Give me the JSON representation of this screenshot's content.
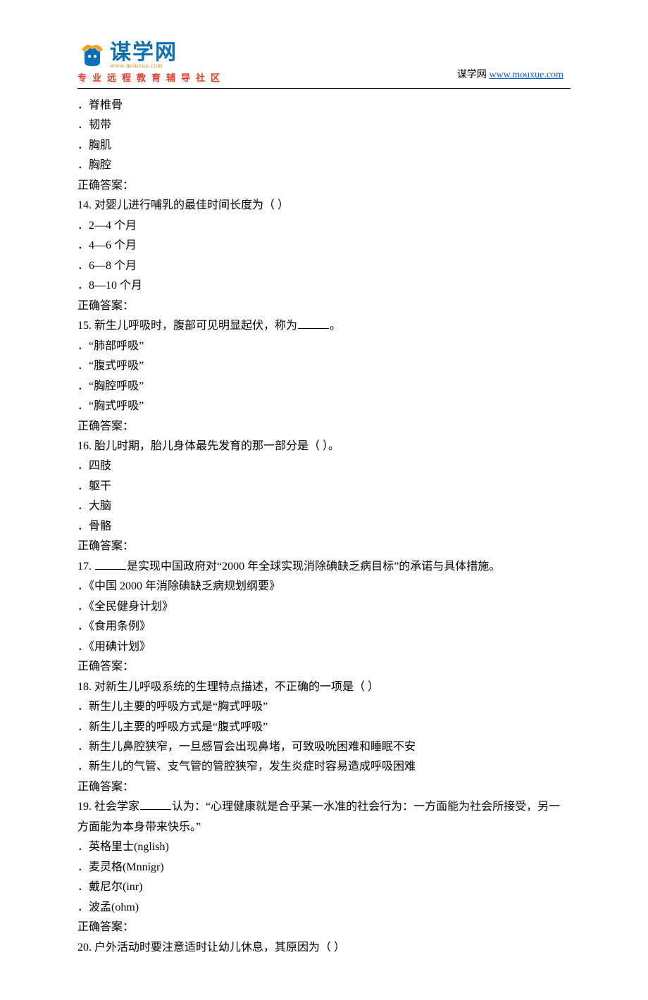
{
  "header": {
    "logo_cn": "谋学网",
    "logo_url": "www.mouxue.com",
    "logo_sub": "专业远程教育辅导社区",
    "right_prefix": "谋学网 ",
    "right_link": "www.mouxue.com"
  },
  "questions": [
    {
      "number": null,
      "stem_parts": null,
      "options": [
        "脊椎骨",
        "韧带",
        "胸肌",
        "胸腔"
      ],
      "answer_label": "正确答案："
    },
    {
      "number": "14.",
      "stem_parts": [
        "对婴儿进行哺乳的最佳时间长度为（ ）"
      ],
      "options": [
        "2—4 个月",
        "4—6 个月",
        "6—8 个月",
        "8—10 个月"
      ],
      "answer_label": "正确答案："
    },
    {
      "number": "15.",
      "stem_parts": [
        "新生儿呼吸时，腹部可见明显起伏，称为",
        "BLANK",
        "。"
      ],
      "options": [
        "“肺部呼吸”",
        "“腹式呼吸”",
        "“胸腔呼吸”",
        "“胸式呼吸”"
      ],
      "answer_label": "正确答案："
    },
    {
      "number": "16.",
      "stem_parts": [
        "胎儿时期，胎儿身体最先发育的那一部分是（ ）。"
      ],
      "options": [
        "四肢",
        "躯干",
        "大脑",
        "骨骼"
      ],
      "answer_label": "正确答案："
    },
    {
      "number": "17.",
      "stem_parts": [
        "BLANK",
        "是实现中国政府对“2000 年全球实现消除碘缺乏病目标”的承诺与具体措施。"
      ],
      "options": [
        "《中国 2000 年消除碘缺乏病规划纲要》",
        "《全民健身计划》",
        "《食用条例》",
        "《用碘计划》"
      ],
      "answer_label": "正确答案："
    },
    {
      "number": "18.",
      "stem_parts": [
        "对新生儿呼吸系统的生理特点描述，不正确的一项是（ ）"
      ],
      "options": [
        "新生儿主要的呼吸方式是“胸式呼吸”",
        "新生儿主要的呼吸方式是“腹式呼吸”",
        "新生儿鼻腔狭窄，一旦感冒会出现鼻堵，可致吸吮困难和睡眠不安",
        "新生儿的气管、支气管的管腔狭窄，发生炎症时容易造成呼吸困难"
      ],
      "answer_label": "正确答案："
    },
    {
      "number": "19.",
      "stem_parts": [
        "社会学家",
        "BLANK",
        "认为：“心理健康就是合乎某一水准的社会行为：一方面能为社会所接受，另一方面能为本身带来快乐。”"
      ],
      "options": [
        "英格里士(nglish)",
        "麦灵格(Mnnigr)",
        "戴尼尔(inr)",
        "波孟(ohm)"
      ],
      "answer_label": "正确答案："
    },
    {
      "number": "20.",
      "stem_parts": [
        "户外活动时要注意适时让幼儿休息，其原因为（ ）"
      ],
      "options": [],
      "answer_label": null
    }
  ]
}
